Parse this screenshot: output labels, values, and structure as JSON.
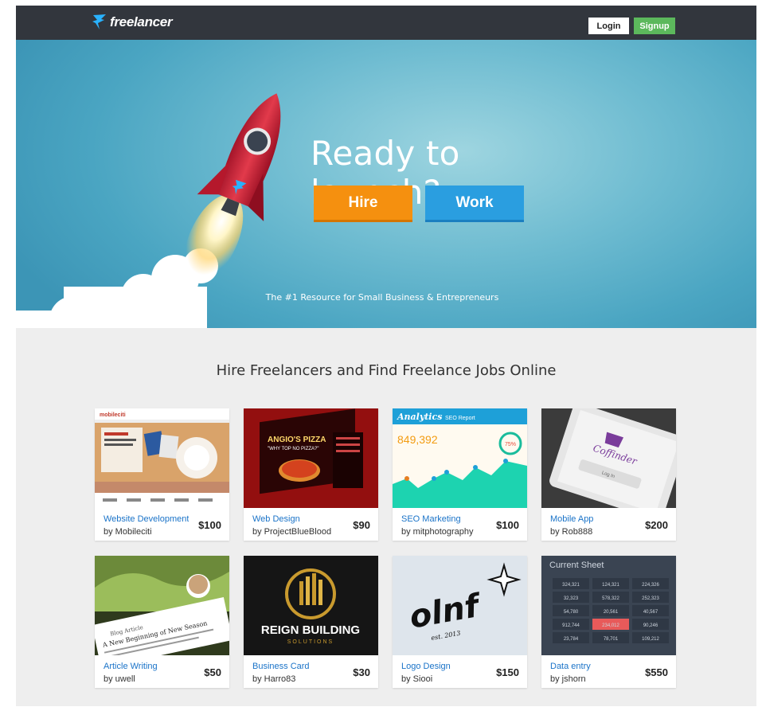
{
  "nav": {
    "brand": "freelancer",
    "login_label": "Login",
    "signup_label": "Signup",
    "signup_color": "#5cb85c"
  },
  "hero": {
    "title": "Ready to launch?",
    "hire_label": "Hire",
    "work_label": "Work",
    "tagline": "The #1 Resource for Small Business & Entrepreneurs",
    "hire_color": "#f5900f",
    "work_color": "#2a9ee0",
    "image_icon": "rocket-launch"
  },
  "section": {
    "title": "Hire Freelancers and Find Freelance Jobs Online"
  },
  "projects": [
    {
      "title": "Website Development",
      "author": "by Mobileciti",
      "price": "$100"
    },
    {
      "title": "Web Design",
      "author": "by ProjectBlueBlood",
      "price": "$90"
    },
    {
      "title": "SEO Marketing",
      "author": "by mitphotography",
      "price": "$100"
    },
    {
      "title": "Mobile App",
      "author": "by Rob888",
      "price": "$200"
    },
    {
      "title": "Article Writing",
      "author": "by uwell",
      "price": "$50"
    },
    {
      "title": "Business Card",
      "author": "by Harro83",
      "price": "$30"
    },
    {
      "title": "Logo Design",
      "author": "by Siooi",
      "price": "$150"
    },
    {
      "title": "Data entry",
      "author": "by jshorn",
      "price": "$550"
    }
  ],
  "thumbs": {
    "website": {
      "brand": "mobileciti"
    },
    "webdesign": {
      "heading": "ANGIO'S PIZZA",
      "sub": "\"WHY TOP NO PIZZA?\""
    },
    "seo": {
      "brand": "Analytics",
      "sub": "SEO Report",
      "figure": "849,392",
      "percent": "75%"
    },
    "mobile": {
      "brand": "Coffinder",
      "button": "Log In"
    },
    "article": {
      "heading": "A New Beginning of New Season",
      "sub": "Blog Article"
    },
    "businesscard": {
      "heading": "REIGN BUILDING",
      "sub": "SOLUTIONS"
    },
    "logo": {
      "mark": "olnf",
      "sub": "est. 2013"
    },
    "dataentry": {
      "heading": "Current Sheet",
      "rows": [
        [
          "324,321",
          "124,321",
          "224,326"
        ],
        [
          "32,323",
          "578,322",
          "252,323"
        ],
        [
          "54,780",
          "20,561",
          "40,567"
        ],
        [
          "912,744",
          "234,012",
          "90,246"
        ],
        [
          "23,784",
          "78,701",
          "109,212"
        ]
      ]
    }
  }
}
